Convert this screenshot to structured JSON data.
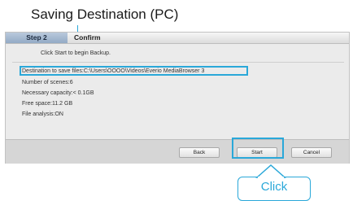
{
  "callout_title": "Saving Destination (PC)",
  "header": {
    "step_label": "Step 2",
    "step_title": "Confirm"
  },
  "message": "Click Start to begin Backup.",
  "info": {
    "destination": "Destination to save files:C:\\Users\\OOOO\\Videos\\Everio MediaBrowser 3",
    "scenes": "Number of scenes:6",
    "capacity": "Necessary capacity:< 0.1GB",
    "free_space": "Free space:11.2 GB",
    "file_analysis": "File analysis:ON"
  },
  "buttons": {
    "back": "Back",
    "start": "Start",
    "cancel": "Cancel"
  },
  "callout_label": "Click",
  "accent_color": "#2aa8d9"
}
